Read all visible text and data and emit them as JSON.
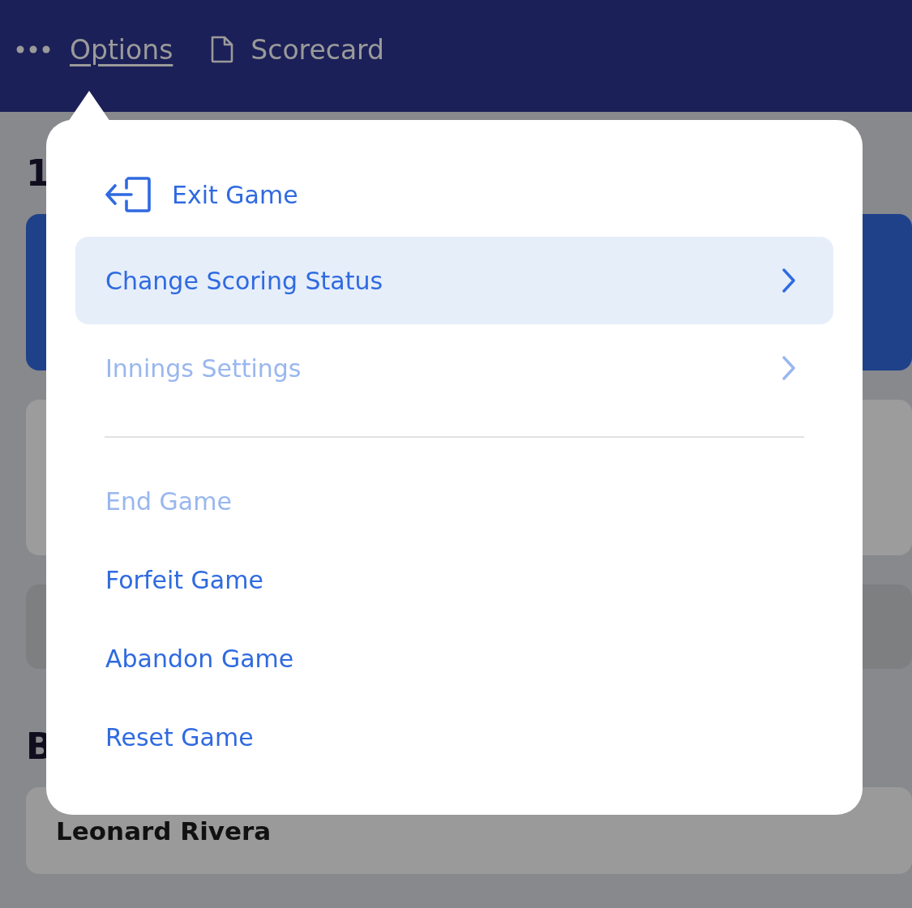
{
  "top_bar": {
    "options_link": "Options",
    "scorecard_tab": "Scorecard"
  },
  "background": {
    "heading": "1",
    "section_heading": "B",
    "player_name": "Leonard Rivera"
  },
  "menu": {
    "items": [
      {
        "kind": "icon",
        "label": "Exit Game",
        "disabled": false,
        "selected": false
      },
      {
        "kind": "submenu",
        "label": "Change Scoring Status",
        "disabled": false,
        "selected": true
      },
      {
        "kind": "submenu",
        "label": "Innings Settings",
        "disabled": true,
        "selected": false
      },
      {
        "kind": "divider"
      },
      {
        "kind": "action",
        "label": "End Game",
        "disabled": true,
        "selected": false
      },
      {
        "kind": "action",
        "label": "Forfeit Game",
        "disabled": false,
        "selected": false
      },
      {
        "kind": "action",
        "label": "Abandon Game",
        "disabled": false,
        "selected": false
      },
      {
        "kind": "action",
        "label": "Reset Game",
        "disabled": false,
        "selected": false
      }
    ]
  }
}
